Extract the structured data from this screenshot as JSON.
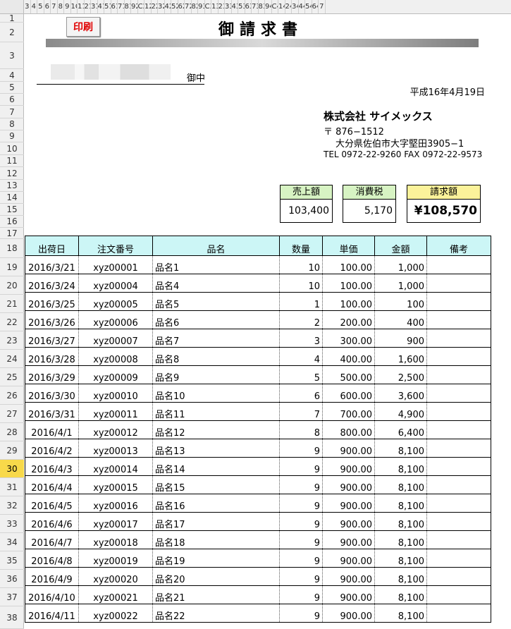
{
  "column_header_text": [
    "3",
    "4",
    "5",
    "6",
    "7",
    "8",
    "9",
    "1C",
    "11",
    "21",
    "31",
    "41",
    "51",
    "61",
    "71",
    "81",
    "92",
    "C2",
    "12",
    "22",
    "32",
    "42",
    "52",
    "62",
    "72",
    "82",
    "93",
    "C3",
    "13",
    "23",
    "33",
    "43",
    "53",
    "63",
    "73",
    "83",
    "94",
    "C4",
    "14",
    "24",
    "34",
    "44",
    "54",
    "64",
    "7"
  ],
  "row_numbers": [
    "1",
    "2",
    "3",
    "4",
    "5",
    "6",
    "7",
    "8",
    "9",
    "10",
    "11",
    "12",
    "13",
    "14",
    "15",
    "16",
    "17",
    "18",
    "19",
    "20",
    "21",
    "22",
    "23",
    "24",
    "25",
    "26",
    "27",
    "28",
    "29",
    "30",
    "31",
    "32",
    "33",
    "34",
    "35",
    "36",
    "37",
    "38"
  ],
  "selected_row": "30",
  "print_button": "印刷",
  "title": "御請求書",
  "recipient_suffix": "御中",
  "date": "平成16年4月19日",
  "sender": {
    "company": "株式会社 サイメックス",
    "postal": "〒 876−1512",
    "address": "大分県佐伯市大字堅田3905−1",
    "tel": "TEL 0972-22-9260 FAX 0972-22-9573"
  },
  "summary": {
    "sales_label": "売上額",
    "sales_value": "103,400",
    "tax_label": "消費税",
    "tax_value": "5,170",
    "total_label": "請求額",
    "total_value": "¥108,570"
  },
  "table": {
    "headers": [
      "出荷日",
      "注文番号",
      "品名",
      "数量",
      "単価",
      "金額",
      "備考"
    ],
    "rows": [
      [
        "2016/3/21",
        "xyz00001",
        "品名1",
        "10",
        "100.00",
        "1,000",
        ""
      ],
      [
        "2016/3/24",
        "xyz00004",
        "品名4",
        "10",
        "100.00",
        "1,000",
        ""
      ],
      [
        "2016/3/25",
        "xyz00005",
        "品名5",
        "1",
        "100.00",
        "100",
        ""
      ],
      [
        "2016/3/26",
        "xyz00006",
        "品名6",
        "2",
        "200.00",
        "400",
        ""
      ],
      [
        "2016/3/27",
        "xyz00007",
        "品名7",
        "3",
        "300.00",
        "900",
        ""
      ],
      [
        "2016/3/28",
        "xyz00008",
        "品名8",
        "4",
        "400.00",
        "1,600",
        ""
      ],
      [
        "2016/3/29",
        "xyz00009",
        "品名9",
        "5",
        "500.00",
        "2,500",
        ""
      ],
      [
        "2016/3/30",
        "xyz00010",
        "品名10",
        "6",
        "600.00",
        "3,600",
        ""
      ],
      [
        "2016/3/31",
        "xyz00011",
        "品名11",
        "7",
        "700.00",
        "4,900",
        ""
      ],
      [
        "2016/4/1",
        "xyz00012",
        "品名12",
        "8",
        "800.00",
        "6,400",
        ""
      ],
      [
        "2016/4/2",
        "xyz00013",
        "品名13",
        "9",
        "900.00",
        "8,100",
        ""
      ],
      [
        "2016/4/3",
        "xyz00014",
        "品名14",
        "9",
        "900.00",
        "8,100",
        ""
      ],
      [
        "2016/4/4",
        "xyz00015",
        "品名15",
        "9",
        "900.00",
        "8,100",
        ""
      ],
      [
        "2016/4/5",
        "xyz00016",
        "品名16",
        "9",
        "900.00",
        "8,100",
        ""
      ],
      [
        "2016/4/6",
        "xyz00017",
        "品名17",
        "9",
        "900.00",
        "8,100",
        ""
      ],
      [
        "2016/4/7",
        "xyz00018",
        "品名18",
        "9",
        "900.00",
        "8,100",
        ""
      ],
      [
        "2016/4/8",
        "xyz00019",
        "品名19",
        "9",
        "900.00",
        "8,100",
        ""
      ],
      [
        "2016/4/9",
        "xyz00020",
        "品名20",
        "9",
        "900.00",
        "8,100",
        ""
      ],
      [
        "2016/4/10",
        "xyz00021",
        "品名21",
        "9",
        "900.00",
        "8,100",
        ""
      ],
      [
        "2016/4/11",
        "xyz00022",
        "品名22",
        "9",
        "900.00",
        "8,100",
        ""
      ]
    ]
  }
}
